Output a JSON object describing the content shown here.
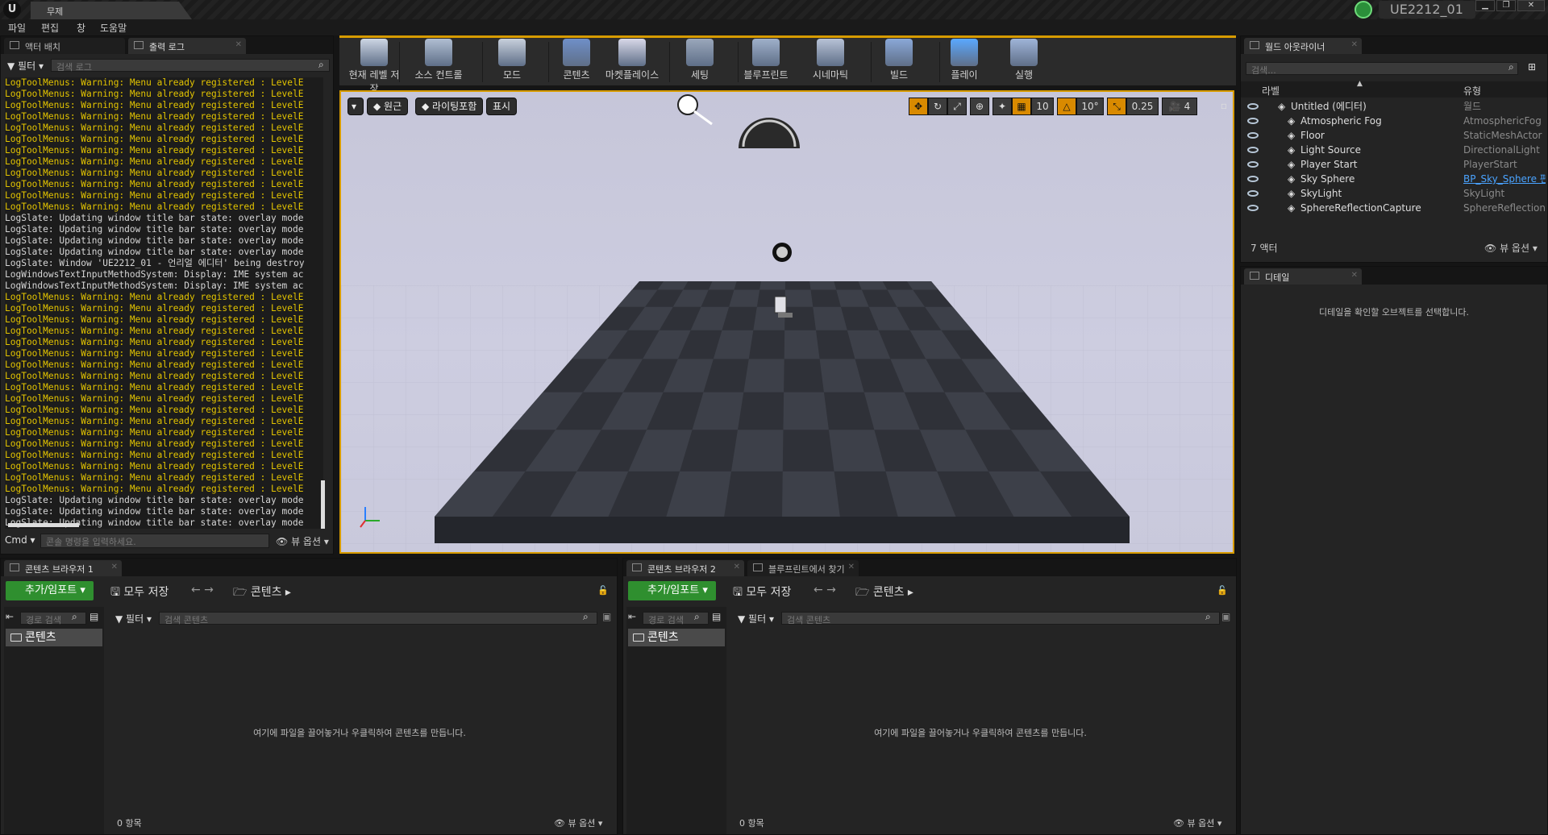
{
  "window": {
    "doc_tab": "무제",
    "project_name": "UE2212_01",
    "controls": [
      "▁",
      "❐",
      "✕"
    ]
  },
  "menu": [
    "파일",
    "편집",
    "창",
    "도움말"
  ],
  "left_panel": {
    "tabs": [
      "액터 배치",
      "출력 로그"
    ],
    "filter_label": "필터",
    "search_placeholder": "검색 로그",
    "cmd_label": "Cmd",
    "cmd_placeholder": "콘솔 명령을 입력하세요.",
    "view_options": "뷰 옵션",
    "log_lines": [
      {
        "t": "warn",
        "s": "LogToolMenus: Warning: Menu already registered : LevelE"
      },
      {
        "t": "warn",
        "s": "LogToolMenus: Warning: Menu already registered : LevelE"
      },
      {
        "t": "warn",
        "s": "LogToolMenus: Warning: Menu already registered : LevelE"
      },
      {
        "t": "warn",
        "s": "LogToolMenus: Warning: Menu already registered : LevelE"
      },
      {
        "t": "warn",
        "s": "LogToolMenus: Warning: Menu already registered : LevelE"
      },
      {
        "t": "warn",
        "s": "LogToolMenus: Warning: Menu already registered : LevelE"
      },
      {
        "t": "warn",
        "s": "LogToolMenus: Warning: Menu already registered : LevelE"
      },
      {
        "t": "warn",
        "s": "LogToolMenus: Warning: Menu already registered : LevelE"
      },
      {
        "t": "warn",
        "s": "LogToolMenus: Warning: Menu already registered : LevelE"
      },
      {
        "t": "warn",
        "s": "LogToolMenus: Warning: Menu already registered : LevelE"
      },
      {
        "t": "warn",
        "s": "LogToolMenus: Warning: Menu already registered : LevelE"
      },
      {
        "t": "warn",
        "s": "LogToolMenus: Warning: Menu already registered : LevelE"
      },
      {
        "t": "info",
        "s": "LogSlate: Updating window title bar state: overlay mode"
      },
      {
        "t": "info",
        "s": "LogSlate: Updating window title bar state: overlay mode"
      },
      {
        "t": "info",
        "s": "LogSlate: Updating window title bar state: overlay mode"
      },
      {
        "t": "info",
        "s": "LogSlate: Updating window title bar state: overlay mode"
      },
      {
        "t": "info",
        "s": "LogSlate: Window 'UE2212_01 - 언리얼 에디터' being destroy"
      },
      {
        "t": "info",
        "s": "LogWindowsTextInputMethodSystem: Display: IME system ac"
      },
      {
        "t": "info",
        "s": "LogWindowsTextInputMethodSystem: Display: IME system ac"
      },
      {
        "t": "warn",
        "s": "LogToolMenus: Warning: Menu already registered : LevelE"
      },
      {
        "t": "warn",
        "s": "LogToolMenus: Warning: Menu already registered : LevelE"
      },
      {
        "t": "warn",
        "s": "LogToolMenus: Warning: Menu already registered : LevelE"
      },
      {
        "t": "warn",
        "s": "LogToolMenus: Warning: Menu already registered : LevelE"
      },
      {
        "t": "warn",
        "s": "LogToolMenus: Warning: Menu already registered : LevelE"
      },
      {
        "t": "warn",
        "s": "LogToolMenus: Warning: Menu already registered : LevelE"
      },
      {
        "t": "warn",
        "s": "LogToolMenus: Warning: Menu already registered : LevelE"
      },
      {
        "t": "warn",
        "s": "LogToolMenus: Warning: Menu already registered : LevelE"
      },
      {
        "t": "warn",
        "s": "LogToolMenus: Warning: Menu already registered : LevelE"
      },
      {
        "t": "warn",
        "s": "LogToolMenus: Warning: Menu already registered : LevelE"
      },
      {
        "t": "warn",
        "s": "LogToolMenus: Warning: Menu already registered : LevelE"
      },
      {
        "t": "warn",
        "s": "LogToolMenus: Warning: Menu already registered : LevelE"
      },
      {
        "t": "warn",
        "s": "LogToolMenus: Warning: Menu already registered : LevelE"
      },
      {
        "t": "warn",
        "s": "LogToolMenus: Warning: Menu already registered : LevelE"
      },
      {
        "t": "warn",
        "s": "LogToolMenus: Warning: Menu already registered : LevelE"
      },
      {
        "t": "warn",
        "s": "LogToolMenus: Warning: Menu already registered : LevelE"
      },
      {
        "t": "warn",
        "s": "LogToolMenus: Warning: Menu already registered : LevelE"
      },
      {
        "t": "warn",
        "s": "LogToolMenus: Warning: Menu already registered : LevelE"
      },
      {
        "t": "info",
        "s": "LogSlate: Updating window title bar state: overlay mode"
      },
      {
        "t": "info",
        "s": "LogSlate: Updating window title bar state: overlay mode"
      },
      {
        "t": "info",
        "s": "LogSlate: Updating window title bar state: overlay mode"
      },
      {
        "t": "info",
        "s": "LogSlate: Updating window title bar state: overlay mode"
      }
    ]
  },
  "toolbar": [
    {
      "label": "현재 레벨 저장",
      "icon": "save-icon"
    },
    {
      "label": "소스 컨트롤",
      "icon": "source-control-icon"
    },
    {
      "label": "모드",
      "icon": "modes-icon"
    },
    {
      "label": "콘텐츠",
      "icon": "content-icon"
    },
    {
      "label": "마켓플레이스",
      "icon": "marketplace-icon"
    },
    {
      "label": "세팅",
      "icon": "settings-icon"
    },
    {
      "label": "블루프린트",
      "icon": "blueprint-icon"
    },
    {
      "label": "시네마틱",
      "icon": "cinematics-icon"
    },
    {
      "label": "빌드",
      "icon": "build-icon"
    },
    {
      "label": "플레이",
      "icon": "play-icon"
    },
    {
      "label": "실행",
      "icon": "launch-icon"
    }
  ],
  "viewport": {
    "perspective": "원근",
    "lit": "라이팅포함",
    "show": "표시",
    "grid_snap": "10",
    "rot_snap": "10°",
    "scale_snap": "0.25",
    "cam_speed": "4"
  },
  "outliner": {
    "tab": "월드 아웃라이너",
    "search_placeholder": "검색...",
    "col_label": "라벨",
    "col_type": "유형",
    "root": {
      "label": "Untitled (에디터)",
      "type": "월드"
    },
    "items": [
      {
        "label": "Atmospheric Fog",
        "type": "AtmosphericFog",
        "link": false
      },
      {
        "label": "Floor",
        "type": "StaticMeshActor",
        "link": false
      },
      {
        "label": "Light Source",
        "type": "DirectionalLight",
        "link": false
      },
      {
        "label": "Player Start",
        "type": "PlayerStart",
        "link": false
      },
      {
        "label": "Sky Sphere",
        "type": "BP_Sky_Sphere 편",
        "link": true
      },
      {
        "label": "SkyLight",
        "type": "SkyLight",
        "link": false
      },
      {
        "label": "SphereReflectionCapture",
        "type": "SphereReflectionC",
        "link": false
      }
    ],
    "count": "7 액터",
    "view_options": "뷰 옵션"
  },
  "details": {
    "tab": "디테일",
    "empty": "디테일을 확인할 오브젝트를 선택합니다."
  },
  "content_browsers": [
    {
      "tabs": [
        "콘텐츠 브라우저 1"
      ],
      "add_import": "추가/임포트",
      "save_all": "모두 저장",
      "path": "콘텐츠",
      "path_search": "경로 검색",
      "filter": "필터",
      "search_placeholder": "검색 콘텐츠",
      "folder": "콘텐츠",
      "hint": "여기에 파일을 끌어놓거나 우클릭하여 콘텐츠를 만듭니다.",
      "count": "0 항목",
      "view_options": "뷰 옵션"
    },
    {
      "tabs": [
        "콘텐츠 브라우저 2",
        "블루프린트에서 찾기"
      ],
      "add_import": "추가/임포트",
      "save_all": "모두 저장",
      "path": "콘텐츠",
      "path_search": "경로 검색",
      "filter": "필터",
      "search_placeholder": "검색 콘텐츠",
      "folder": "콘텐츠",
      "hint": "여기에 파일을 끌어놓거나 우클릭하여 콘텐츠를 만듭니다.",
      "count": "0 항목",
      "view_options": "뷰 옵션"
    }
  ]
}
